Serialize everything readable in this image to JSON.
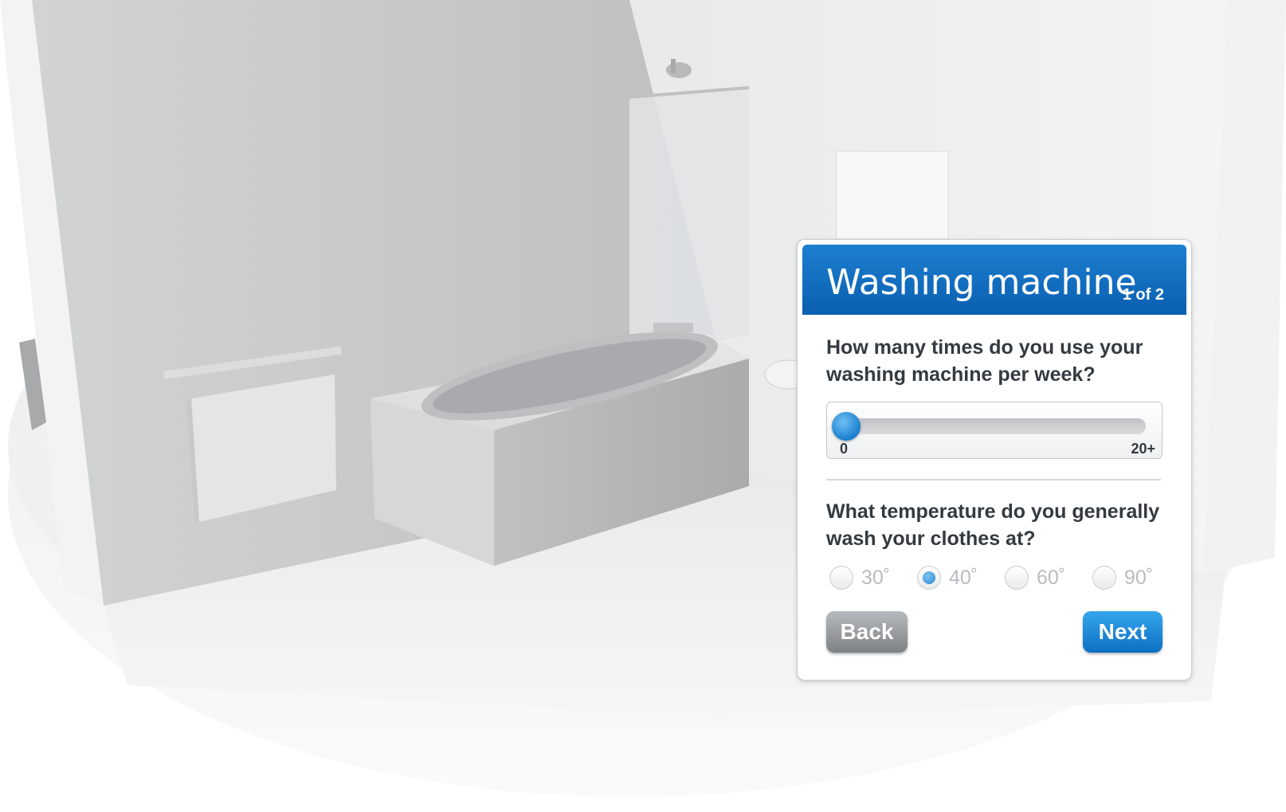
{
  "panel": {
    "title": "Washing machine",
    "step": "1 of 2",
    "question1": "How many times do you use your washing machine per week?",
    "slider": {
      "min_label": "0",
      "max_label": "20+",
      "value": 0
    },
    "question2": "What temperature do you generally wash your clothes at?",
    "temperature_options": [
      {
        "label": "30˚",
        "selected": false
      },
      {
        "label": "40˚",
        "selected": true
      },
      {
        "label": "60˚",
        "selected": false
      },
      {
        "label": "90˚",
        "selected": false
      }
    ],
    "back_label": "Back",
    "next_label": "Next"
  },
  "colors": {
    "header_blue": "#0a5fb0",
    "next_button": "#0d6fc4",
    "back_button": "#8d9194"
  }
}
